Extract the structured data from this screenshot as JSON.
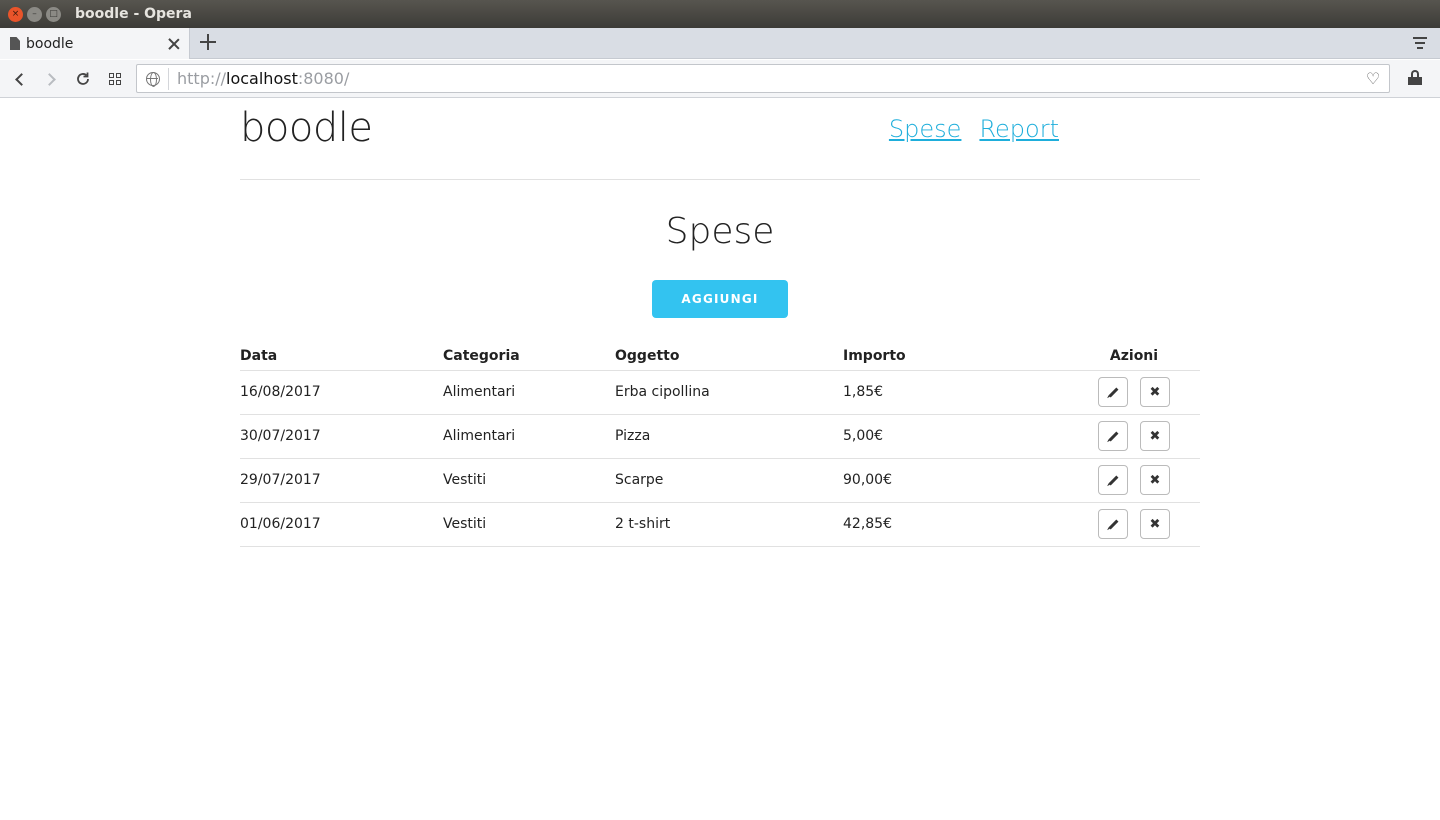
{
  "window": {
    "title": "boodle - Opera",
    "close_glyph": "×",
    "minimize_glyph": "–",
    "maximize_glyph": "□"
  },
  "browser": {
    "tab": {
      "title": "boodle"
    },
    "url": {
      "scheme": "http://",
      "host": "localhost",
      "port": ":8080/"
    },
    "heart_glyph": "♡"
  },
  "header": {
    "brand": "boodle",
    "nav": [
      {
        "label": "Spese"
      },
      {
        "label": "Report"
      }
    ]
  },
  "main": {
    "title": "Spese",
    "add_button": "AGGIUNGI",
    "table": {
      "columns": [
        "Data",
        "Categoria",
        "Oggetto",
        "Importo",
        "Azioni"
      ],
      "rows": [
        [
          "16/08/2017",
          "Alimentari",
          "Erba cipollina",
          "1,85€"
        ],
        [
          "30/07/2017",
          "Alimentari",
          "Pizza",
          "5,00€"
        ],
        [
          "29/07/2017",
          "Vestiti",
          "Scarpe",
          "90,00€"
        ],
        [
          "01/06/2017",
          "Vestiti",
          "2 t-shirt",
          "42,85€"
        ]
      ],
      "row_actions": [
        "edit-icon",
        "delete-icon"
      ],
      "delete_glyph": "✖"
    }
  },
  "colors": {
    "accent": "#33c3f0",
    "link": "#1eaedb",
    "text": "#222222",
    "divider": "#e1e1e1"
  }
}
